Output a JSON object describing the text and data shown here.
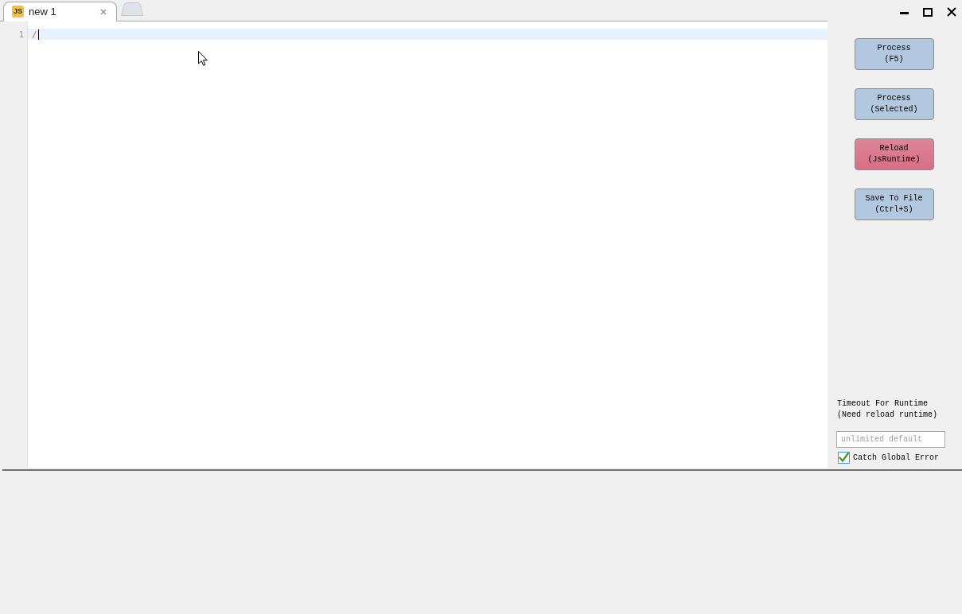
{
  "tabs": [
    {
      "badge": "JS",
      "label": "new 1",
      "selected": true
    }
  ],
  "editor": {
    "lines": [
      {
        "number": "1",
        "text": "/",
        "current": true,
        "caret": true
      }
    ]
  },
  "actions": [
    {
      "label": "Process\n(F5)",
      "kind": "normal"
    },
    {
      "label": "Process\n(Selected)",
      "kind": "normal"
    },
    {
      "label": "Reload\n(JsRuntime)",
      "kind": "danger"
    },
    {
      "label": "Save To File\n(Ctrl+S)",
      "kind": "normal"
    }
  ],
  "timeout": {
    "label": "Timeout For Runtime\n(Need reload runtime)",
    "placeholder": "unlimited default"
  },
  "catch_global_error": {
    "label": "Catch Global Error",
    "checked": true
  }
}
